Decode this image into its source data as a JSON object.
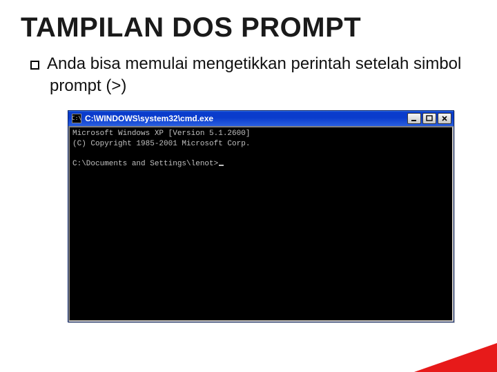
{
  "slide": {
    "title": "TAMPILAN DOS PROMPT",
    "bullet_prefix": "Anda",
    "bullet_rest": " bisa memulai mengetikkan perintah setelah simbol prompt (>)"
  },
  "window": {
    "icon_text": "C:\\",
    "title": "C:\\WINDOWS\\system32\\cmd.exe"
  },
  "terminal": {
    "line1": "Microsoft Windows XP [Version 5.1.2600]",
    "line2": "(C) Copyright 1985-2001 Microsoft Corp.",
    "blank": "",
    "prompt": "C:\\Documents and Settings\\lenot>"
  }
}
